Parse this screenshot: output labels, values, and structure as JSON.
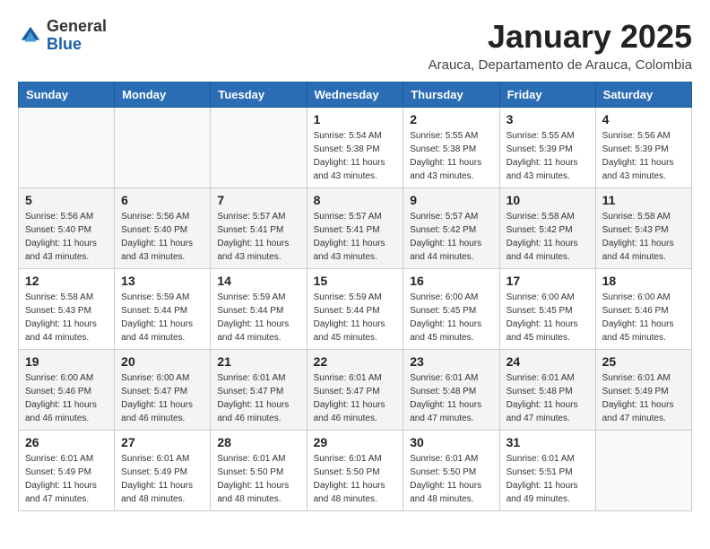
{
  "header": {
    "logo": {
      "general": "General",
      "blue": "Blue"
    },
    "title": "January 2025",
    "subtitle": "Arauca, Departamento de Arauca, Colombia"
  },
  "weekdays": [
    "Sunday",
    "Monday",
    "Tuesday",
    "Wednesday",
    "Thursday",
    "Friday",
    "Saturday"
  ],
  "weeks": [
    [
      {
        "day": "",
        "info": ""
      },
      {
        "day": "",
        "info": ""
      },
      {
        "day": "",
        "info": ""
      },
      {
        "day": "1",
        "info": "Sunrise: 5:54 AM\nSunset: 5:38 PM\nDaylight: 11 hours\nand 43 minutes."
      },
      {
        "day": "2",
        "info": "Sunrise: 5:55 AM\nSunset: 5:38 PM\nDaylight: 11 hours\nand 43 minutes."
      },
      {
        "day": "3",
        "info": "Sunrise: 5:55 AM\nSunset: 5:39 PM\nDaylight: 11 hours\nand 43 minutes."
      },
      {
        "day": "4",
        "info": "Sunrise: 5:56 AM\nSunset: 5:39 PM\nDaylight: 11 hours\nand 43 minutes."
      }
    ],
    [
      {
        "day": "5",
        "info": "Sunrise: 5:56 AM\nSunset: 5:40 PM\nDaylight: 11 hours\nand 43 minutes."
      },
      {
        "day": "6",
        "info": "Sunrise: 5:56 AM\nSunset: 5:40 PM\nDaylight: 11 hours\nand 43 minutes."
      },
      {
        "day": "7",
        "info": "Sunrise: 5:57 AM\nSunset: 5:41 PM\nDaylight: 11 hours\nand 43 minutes."
      },
      {
        "day": "8",
        "info": "Sunrise: 5:57 AM\nSunset: 5:41 PM\nDaylight: 11 hours\nand 43 minutes."
      },
      {
        "day": "9",
        "info": "Sunrise: 5:57 AM\nSunset: 5:42 PM\nDaylight: 11 hours\nand 44 minutes."
      },
      {
        "day": "10",
        "info": "Sunrise: 5:58 AM\nSunset: 5:42 PM\nDaylight: 11 hours\nand 44 minutes."
      },
      {
        "day": "11",
        "info": "Sunrise: 5:58 AM\nSunset: 5:43 PM\nDaylight: 11 hours\nand 44 minutes."
      }
    ],
    [
      {
        "day": "12",
        "info": "Sunrise: 5:58 AM\nSunset: 5:43 PM\nDaylight: 11 hours\nand 44 minutes."
      },
      {
        "day": "13",
        "info": "Sunrise: 5:59 AM\nSunset: 5:44 PM\nDaylight: 11 hours\nand 44 minutes."
      },
      {
        "day": "14",
        "info": "Sunrise: 5:59 AM\nSunset: 5:44 PM\nDaylight: 11 hours\nand 44 minutes."
      },
      {
        "day": "15",
        "info": "Sunrise: 5:59 AM\nSunset: 5:44 PM\nDaylight: 11 hours\nand 45 minutes."
      },
      {
        "day": "16",
        "info": "Sunrise: 6:00 AM\nSunset: 5:45 PM\nDaylight: 11 hours\nand 45 minutes."
      },
      {
        "day": "17",
        "info": "Sunrise: 6:00 AM\nSunset: 5:45 PM\nDaylight: 11 hours\nand 45 minutes."
      },
      {
        "day": "18",
        "info": "Sunrise: 6:00 AM\nSunset: 5:46 PM\nDaylight: 11 hours\nand 45 minutes."
      }
    ],
    [
      {
        "day": "19",
        "info": "Sunrise: 6:00 AM\nSunset: 5:46 PM\nDaylight: 11 hours\nand 46 minutes."
      },
      {
        "day": "20",
        "info": "Sunrise: 6:00 AM\nSunset: 5:47 PM\nDaylight: 11 hours\nand 46 minutes."
      },
      {
        "day": "21",
        "info": "Sunrise: 6:01 AM\nSunset: 5:47 PM\nDaylight: 11 hours\nand 46 minutes."
      },
      {
        "day": "22",
        "info": "Sunrise: 6:01 AM\nSunset: 5:47 PM\nDaylight: 11 hours\nand 46 minutes."
      },
      {
        "day": "23",
        "info": "Sunrise: 6:01 AM\nSunset: 5:48 PM\nDaylight: 11 hours\nand 47 minutes."
      },
      {
        "day": "24",
        "info": "Sunrise: 6:01 AM\nSunset: 5:48 PM\nDaylight: 11 hours\nand 47 minutes."
      },
      {
        "day": "25",
        "info": "Sunrise: 6:01 AM\nSunset: 5:49 PM\nDaylight: 11 hours\nand 47 minutes."
      }
    ],
    [
      {
        "day": "26",
        "info": "Sunrise: 6:01 AM\nSunset: 5:49 PM\nDaylight: 11 hours\nand 47 minutes."
      },
      {
        "day": "27",
        "info": "Sunrise: 6:01 AM\nSunset: 5:49 PM\nDaylight: 11 hours\nand 48 minutes."
      },
      {
        "day": "28",
        "info": "Sunrise: 6:01 AM\nSunset: 5:50 PM\nDaylight: 11 hours\nand 48 minutes."
      },
      {
        "day": "29",
        "info": "Sunrise: 6:01 AM\nSunset: 5:50 PM\nDaylight: 11 hours\nand 48 minutes."
      },
      {
        "day": "30",
        "info": "Sunrise: 6:01 AM\nSunset: 5:50 PM\nDaylight: 11 hours\nand 48 minutes."
      },
      {
        "day": "31",
        "info": "Sunrise: 6:01 AM\nSunset: 5:51 PM\nDaylight: 11 hours\nand 49 minutes."
      },
      {
        "day": "",
        "info": ""
      }
    ]
  ]
}
